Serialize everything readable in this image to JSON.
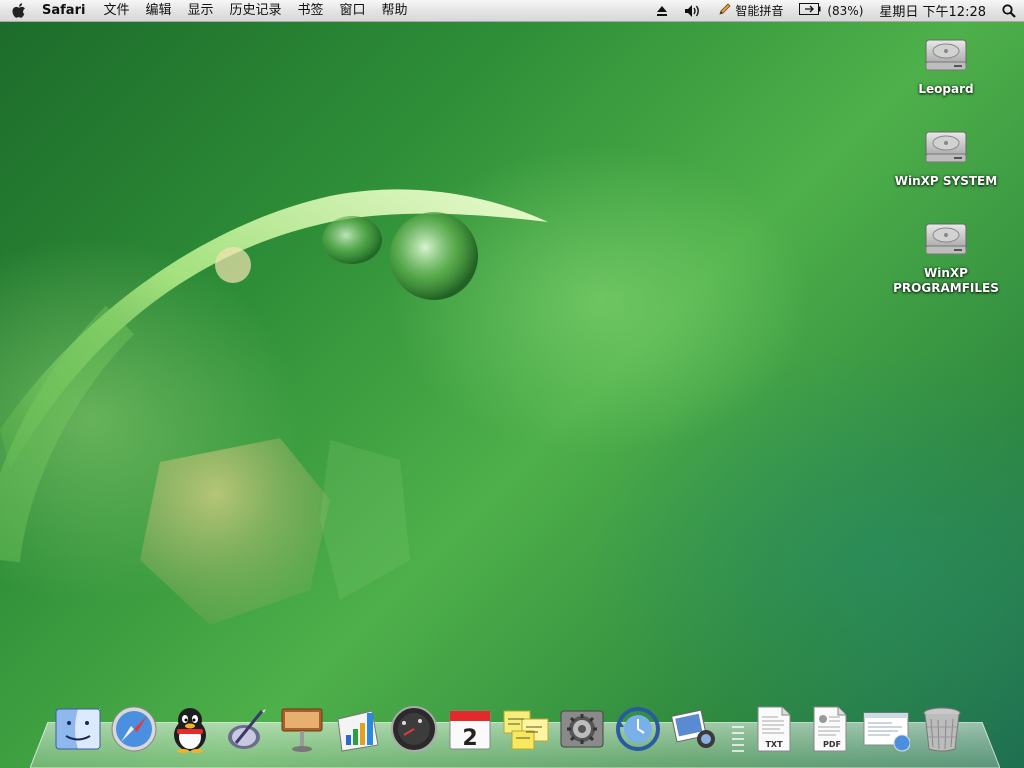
{
  "menubar": {
    "app_name": "Safari",
    "menus": [
      "文件",
      "编辑",
      "显示",
      "历史记录",
      "书签",
      "窗口",
      "帮助"
    ],
    "input_method": "智能拼音",
    "battery_percent": "(83%)",
    "clock": "星期日 下午12:28"
  },
  "desktop": {
    "icons": [
      {
        "label": "Leopard",
        "icon": "hard-drive-icon"
      },
      {
        "label": "WinXP SYSTEM",
        "icon": "hard-drive-icon"
      },
      {
        "label": "WinXP\nPROGRAMFILES",
        "icon": "hard-drive-icon"
      }
    ]
  },
  "dock": {
    "apps": [
      {
        "name": "finder",
        "icon": "finder-icon"
      },
      {
        "name": "safari",
        "icon": "safari-compass-icon"
      },
      {
        "name": "qq",
        "icon": "penguin-icon"
      },
      {
        "name": "mail",
        "icon": "mail-icon"
      },
      {
        "name": "keynote",
        "icon": "keynote-podium-icon"
      },
      {
        "name": "numbers",
        "icon": "chart-icon"
      },
      {
        "name": "dashboard",
        "icon": "dashboard-gauge-icon"
      },
      {
        "name": "ical",
        "icon": "calendar-icon"
      },
      {
        "name": "stickies",
        "icon": "stickies-icon"
      },
      {
        "name": "system-preferences",
        "icon": "gear-icon"
      },
      {
        "name": "time-machine",
        "icon": "time-machine-icon"
      },
      {
        "name": "iphoto",
        "icon": "photo-icon"
      }
    ],
    "calendar_day": "2",
    "docs": [
      {
        "name": "txt-document",
        "badge": "TXT"
      },
      {
        "name": "pdf-document",
        "badge": "PDF"
      },
      {
        "name": "web-document",
        "badge": ""
      }
    ],
    "trash": {
      "name": "trash",
      "icon": "trash-icon"
    }
  },
  "colors": {
    "wallpaper_primary": "#2e8e38",
    "wallpaper_highlight": "#8ee07a",
    "menubar_bg": "#e8e8e8"
  }
}
